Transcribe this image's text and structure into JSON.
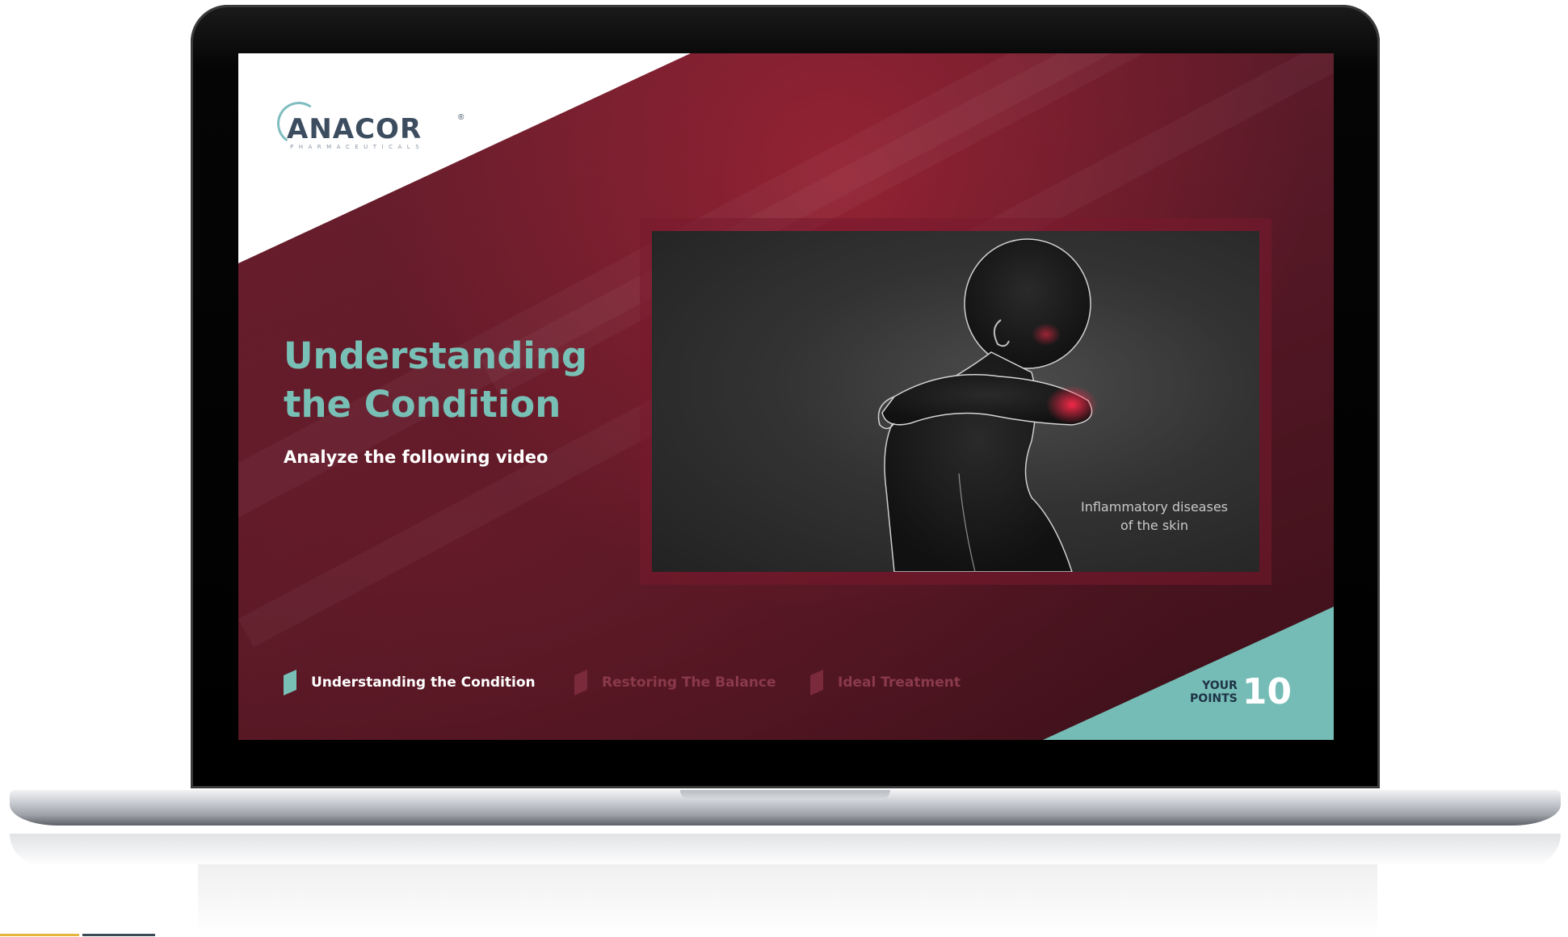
{
  "brand": {
    "name": "ANACOR",
    "tagline": "PHARMACEUTICALS",
    "registered": "®"
  },
  "lesson": {
    "title": "Understanding the Condition",
    "subtitle": "Analyze the following video"
  },
  "video": {
    "caption": "Inflammatory diseases of the skin"
  },
  "nav": {
    "items": [
      {
        "label": "Understanding the Condition",
        "state": "active"
      },
      {
        "label": "Restoring The Balance",
        "state": "inactive"
      },
      {
        "label": "Ideal Treatment",
        "state": "inactive"
      }
    ]
  },
  "score": {
    "label": "YOUR POINTS",
    "value": "10"
  },
  "colors": {
    "accent_teal": "#78bfb6",
    "background_maroon": "#5a1a28",
    "logo_text": "#3d4d60"
  }
}
